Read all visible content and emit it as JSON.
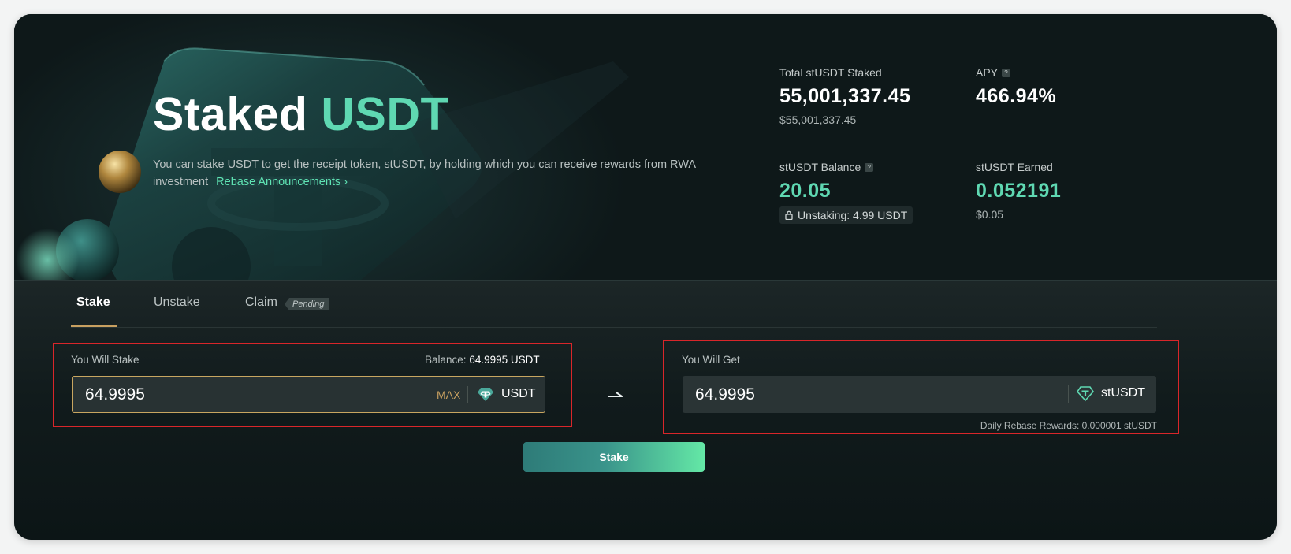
{
  "hero": {
    "title_part1": "Staked",
    "title_part2": "USDT",
    "description": "You can stake USDT to get the receipt token, stUSDT, by holding which you can receive rewards from RWA investment",
    "link_label": "Rebase Announcements",
    "link_chevron": "›"
  },
  "stats": {
    "total_staked": {
      "label": "Total stUSDT Staked",
      "value": "55,001,337.45",
      "usd": "$55,001,337.45"
    },
    "apy": {
      "label": "APY",
      "help": "?",
      "value": "466.94%"
    },
    "balance": {
      "label": "stUSDT Balance",
      "help": "?",
      "value": "20.05",
      "unstaking": "Unstaking: 4.99 USDT",
      "unstaking_icon": "lock-icon"
    },
    "earned": {
      "label": "stUSDT Earned",
      "value": "0.052191",
      "usd": "$0.05"
    }
  },
  "tabs": [
    {
      "label": "Stake",
      "active": true
    },
    {
      "label": "Unstake",
      "active": false
    },
    {
      "label": "Claim",
      "active": false,
      "badge": "Pending"
    }
  ],
  "stake_panel": {
    "label": "You Will Stake",
    "balance_label": "Balance:",
    "balance_value": "64.9995 USDT",
    "amount": "64.9995",
    "max_label": "MAX",
    "token": "USDT",
    "token_icon": "tether-icon"
  },
  "arrow_icon": "arrow-right-icon",
  "get_panel": {
    "label": "You Will Get",
    "amount": "64.9995",
    "token": "stUSDT",
    "token_icon": "tether-outline-icon",
    "daily_rewards": "Daily Rebase Rewards: 0.000001 stUSDT"
  },
  "stake_button": "Stake",
  "colors": {
    "accent_green": "#5fd8b2",
    "gold": "#c8a060",
    "background": "#0c1617",
    "highlight_border": "#d9262a"
  }
}
